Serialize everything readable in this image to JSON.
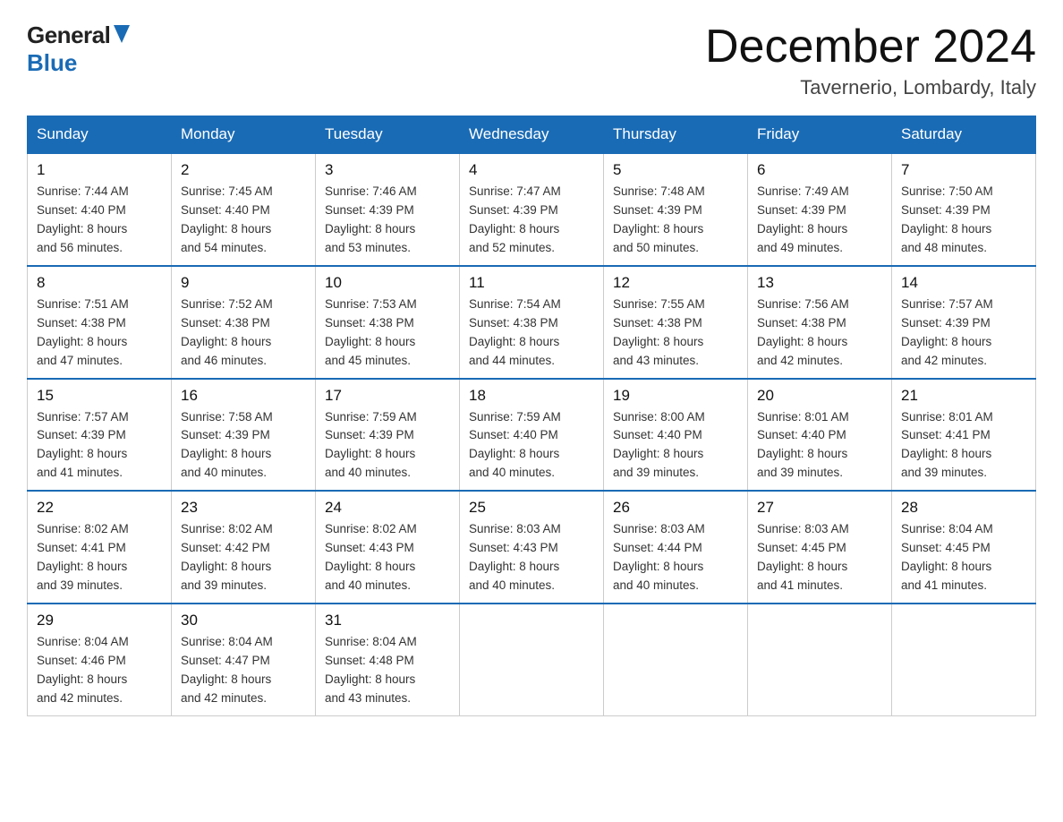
{
  "header": {
    "logo_general": "General",
    "logo_blue": "Blue",
    "month_title": "December 2024",
    "location": "Tavernerio, Lombardy, Italy"
  },
  "days_of_week": [
    "Sunday",
    "Monday",
    "Tuesday",
    "Wednesday",
    "Thursday",
    "Friday",
    "Saturday"
  ],
  "weeks": [
    [
      {
        "day": "1",
        "sunrise": "7:44 AM",
        "sunset": "4:40 PM",
        "daylight": "8 hours and 56 minutes."
      },
      {
        "day": "2",
        "sunrise": "7:45 AM",
        "sunset": "4:40 PM",
        "daylight": "8 hours and 54 minutes."
      },
      {
        "day": "3",
        "sunrise": "7:46 AM",
        "sunset": "4:39 PM",
        "daylight": "8 hours and 53 minutes."
      },
      {
        "day": "4",
        "sunrise": "7:47 AM",
        "sunset": "4:39 PM",
        "daylight": "8 hours and 52 minutes."
      },
      {
        "day": "5",
        "sunrise": "7:48 AM",
        "sunset": "4:39 PM",
        "daylight": "8 hours and 50 minutes."
      },
      {
        "day": "6",
        "sunrise": "7:49 AM",
        "sunset": "4:39 PM",
        "daylight": "8 hours and 49 minutes."
      },
      {
        "day": "7",
        "sunrise": "7:50 AM",
        "sunset": "4:39 PM",
        "daylight": "8 hours and 48 minutes."
      }
    ],
    [
      {
        "day": "8",
        "sunrise": "7:51 AM",
        "sunset": "4:38 PM",
        "daylight": "8 hours and 47 minutes."
      },
      {
        "day": "9",
        "sunrise": "7:52 AM",
        "sunset": "4:38 PM",
        "daylight": "8 hours and 46 minutes."
      },
      {
        "day": "10",
        "sunrise": "7:53 AM",
        "sunset": "4:38 PM",
        "daylight": "8 hours and 45 minutes."
      },
      {
        "day": "11",
        "sunrise": "7:54 AM",
        "sunset": "4:38 PM",
        "daylight": "8 hours and 44 minutes."
      },
      {
        "day": "12",
        "sunrise": "7:55 AM",
        "sunset": "4:38 PM",
        "daylight": "8 hours and 43 minutes."
      },
      {
        "day": "13",
        "sunrise": "7:56 AM",
        "sunset": "4:38 PM",
        "daylight": "8 hours and 42 minutes."
      },
      {
        "day": "14",
        "sunrise": "7:57 AM",
        "sunset": "4:39 PM",
        "daylight": "8 hours and 42 minutes."
      }
    ],
    [
      {
        "day": "15",
        "sunrise": "7:57 AM",
        "sunset": "4:39 PM",
        "daylight": "8 hours and 41 minutes."
      },
      {
        "day": "16",
        "sunrise": "7:58 AM",
        "sunset": "4:39 PM",
        "daylight": "8 hours and 40 minutes."
      },
      {
        "day": "17",
        "sunrise": "7:59 AM",
        "sunset": "4:39 PM",
        "daylight": "8 hours and 40 minutes."
      },
      {
        "day": "18",
        "sunrise": "7:59 AM",
        "sunset": "4:40 PM",
        "daylight": "8 hours and 40 minutes."
      },
      {
        "day": "19",
        "sunrise": "8:00 AM",
        "sunset": "4:40 PM",
        "daylight": "8 hours and 39 minutes."
      },
      {
        "day": "20",
        "sunrise": "8:01 AM",
        "sunset": "4:40 PM",
        "daylight": "8 hours and 39 minutes."
      },
      {
        "day": "21",
        "sunrise": "8:01 AM",
        "sunset": "4:41 PM",
        "daylight": "8 hours and 39 minutes."
      }
    ],
    [
      {
        "day": "22",
        "sunrise": "8:02 AM",
        "sunset": "4:41 PM",
        "daylight": "8 hours and 39 minutes."
      },
      {
        "day": "23",
        "sunrise": "8:02 AM",
        "sunset": "4:42 PM",
        "daylight": "8 hours and 39 minutes."
      },
      {
        "day": "24",
        "sunrise": "8:02 AM",
        "sunset": "4:43 PM",
        "daylight": "8 hours and 40 minutes."
      },
      {
        "day": "25",
        "sunrise": "8:03 AM",
        "sunset": "4:43 PM",
        "daylight": "8 hours and 40 minutes."
      },
      {
        "day": "26",
        "sunrise": "8:03 AM",
        "sunset": "4:44 PM",
        "daylight": "8 hours and 40 minutes."
      },
      {
        "day": "27",
        "sunrise": "8:03 AM",
        "sunset": "4:45 PM",
        "daylight": "8 hours and 41 minutes."
      },
      {
        "day": "28",
        "sunrise": "8:04 AM",
        "sunset": "4:45 PM",
        "daylight": "8 hours and 41 minutes."
      }
    ],
    [
      {
        "day": "29",
        "sunrise": "8:04 AM",
        "sunset": "4:46 PM",
        "daylight": "8 hours and 42 minutes."
      },
      {
        "day": "30",
        "sunrise": "8:04 AM",
        "sunset": "4:47 PM",
        "daylight": "8 hours and 42 minutes."
      },
      {
        "day": "31",
        "sunrise": "8:04 AM",
        "sunset": "4:48 PM",
        "daylight": "8 hours and 43 minutes."
      },
      null,
      null,
      null,
      null
    ]
  ],
  "labels": {
    "sunrise": "Sunrise:",
    "sunset": "Sunset:",
    "daylight": "Daylight:"
  }
}
